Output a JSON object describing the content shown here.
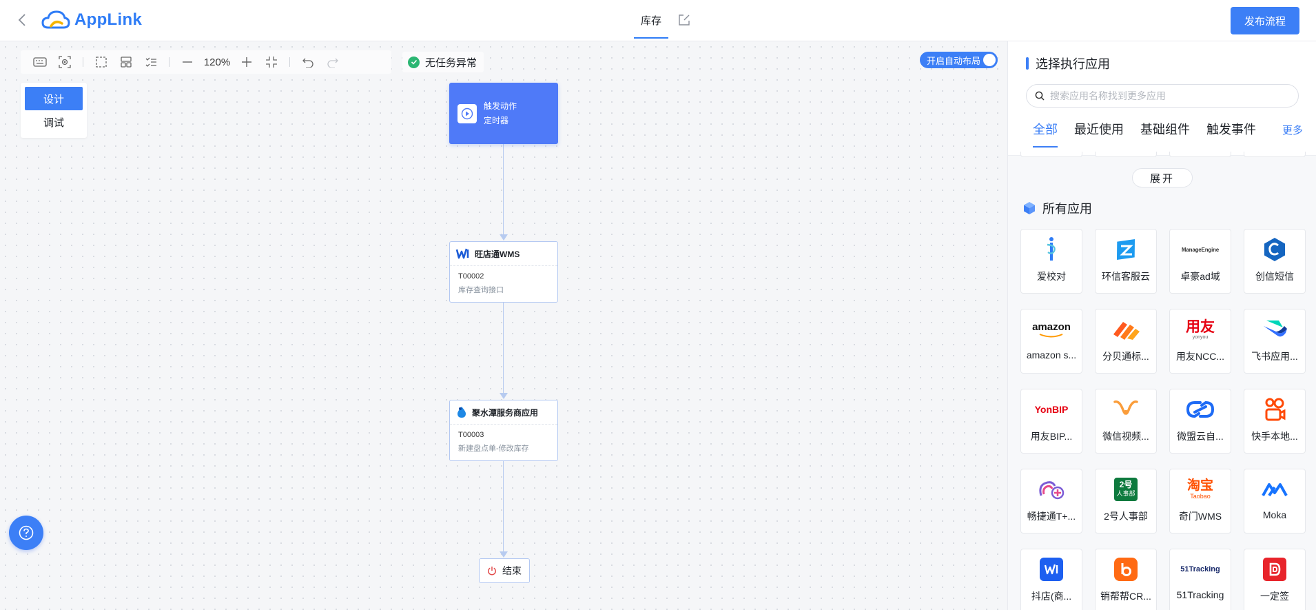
{
  "header": {
    "brand": "AppLink",
    "tab_title": "库存",
    "publish_label": "发布流程"
  },
  "toolbar": {
    "zoom": "120%",
    "status_text": "无任务异常",
    "auto_layout_label": "开启自动布局"
  },
  "mode_panel": {
    "design_label": "设计",
    "debug_label": "调试"
  },
  "flow": {
    "trigger": {
      "line1": "触发动作",
      "line2": "定时器"
    },
    "nodes": [
      {
        "app": "旺店通WMS",
        "code": "T00002",
        "desc": "库存查询接口"
      },
      {
        "app": "聚水潭服务商应用",
        "code": "T00003",
        "desc": "新建盘点单-修改库存"
      }
    ],
    "end_label": "结束"
  },
  "panel": {
    "title": "选择执行应用",
    "search_placeholder": "搜索应用名称找到更多应用",
    "tabs": [
      "全部",
      "最近使用",
      "基础组件",
      "触发事件"
    ],
    "active_tab": "全部",
    "more_label": "更多",
    "expand_label": "展开",
    "section_title": "所有应用",
    "logo_texts": {
      "manageengine": "ManageEngine",
      "amazon": "amazon",
      "yonyou": "用友",
      "yonyou_sub": "yonyou",
      "yonbip": "YonBIP",
      "hr2": "2号",
      "hr2_sub": "人事部",
      "taobao": "淘宝",
      "taobao_sub": "Taobao",
      "tracking51": "51Tracking"
    },
    "apps": [
      {
        "name": "爱校对",
        "icon": "aixiaodui-logo-icon"
      },
      {
        "name": "环信客服云",
        "icon": "huanxin-logo-icon"
      },
      {
        "name": "卓豪ad域",
        "icon": "manageengine-logo-icon"
      },
      {
        "name": "创信短信",
        "icon": "chuangxin-logo-icon"
      },
      {
        "name": "amazon s...",
        "icon": "amazon-logo-icon"
      },
      {
        "name": "分贝通标...",
        "icon": "fenbeitong-logo-icon"
      },
      {
        "name": "用友NCC...",
        "icon": "yonyou-logo-icon"
      },
      {
        "name": "飞书应用...",
        "icon": "feishu-logo-icon"
      },
      {
        "name": "用友BIP...",
        "icon": "yonbip-logo-icon"
      },
      {
        "name": "微信视频...",
        "icon": "wechat-channels-logo-icon"
      },
      {
        "name": "微盟云自...",
        "icon": "weimeng-logo-icon"
      },
      {
        "name": "快手本地...",
        "icon": "kuaishou-logo-icon"
      },
      {
        "name": "畅捷通T+...",
        "icon": "changjietong-logo-icon"
      },
      {
        "name": "2号人事部",
        "icon": "hr2-logo-icon"
      },
      {
        "name": "奇门WMS",
        "icon": "taobao-logo-icon"
      },
      {
        "name": "Moka",
        "icon": "moka-logo-icon"
      },
      {
        "name": "抖店(商...",
        "icon": "doudian-logo-icon"
      },
      {
        "name": "销帮帮CR...",
        "icon": "xiaobangbang-logo-icon"
      },
      {
        "name": "51Tracking",
        "icon": "tracking51-logo-icon"
      },
      {
        "name": "一定签",
        "icon": "yidingqian-logo-icon"
      }
    ]
  },
  "colors": {
    "accent": "#3c7ff6",
    "trigger": "#4f7af8",
    "success": "#2bb673"
  }
}
